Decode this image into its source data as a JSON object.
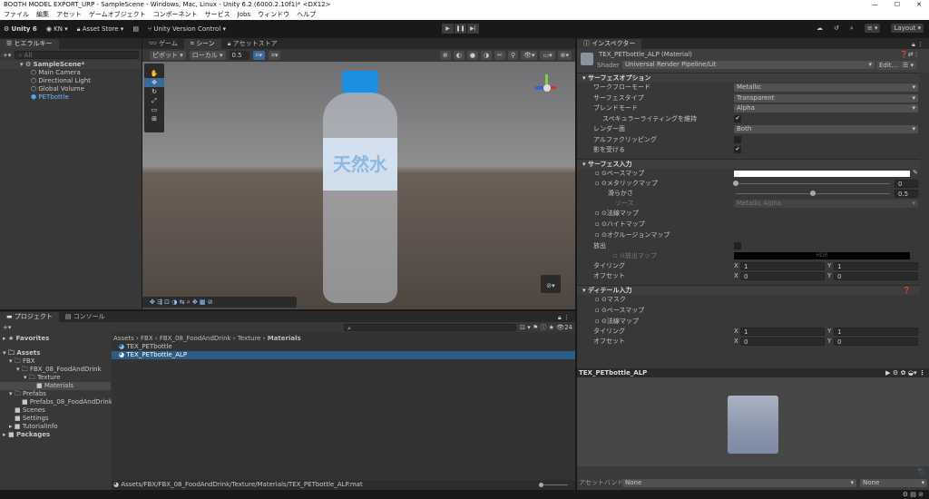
{
  "window": {
    "title": "BOOTH MODEL EXPORT_URP - SampleScene - Windows, Mac, Linux - Unity 6.2 (6000.2.10f1)* <DX12>"
  },
  "menu": [
    "ファイル",
    "編集",
    "アセット",
    "ゲームオブジェクト",
    "コンポーネント",
    "サービス",
    "Jobs",
    "ウィンドウ",
    "ヘルプ"
  ],
  "toolbar": {
    "unity": "Unity 6",
    "account": "KN",
    "asset_store": "Asset Store",
    "version_control": "Unity Version Control",
    "layout": "Layout"
  },
  "hierarchy": {
    "tab": "ヒエラルキー",
    "search_placeholder": "All",
    "scene": "SampleScene*",
    "items": [
      "Main Camera",
      "Directional Light",
      "Global Volume",
      "PETbottle"
    ]
  },
  "scene_tabs": [
    "ゲーム",
    "シーン",
    "アセットストア"
  ],
  "scene_toolbar": {
    "pivot": "ピボット",
    "local": "ローカル",
    "snap": "0.5"
  },
  "bottle_label": "天然水",
  "inspector": {
    "tab": "インスペクター",
    "name": "TEX_PETbottle_ALP (Material)",
    "shader_label": "Shader",
    "shader": "Universal Render Pipeline/Lit",
    "edit": "Edit...",
    "surface_options": {
      "title": "サーフェスオプション",
      "rows": [
        {
          "label": "ワークフローモード",
          "value": "Metallic"
        },
        {
          "label": "サーフェスタイプ",
          "value": "Transparent"
        },
        {
          "label": "ブレンドモード",
          "value": "Alpha"
        },
        {
          "label": "スペキュラーライティングを維持",
          "check": "✔"
        },
        {
          "label": "レンダー面",
          "value": "Both"
        },
        {
          "label": "アルファクリッピング",
          "check": ""
        },
        {
          "label": "影を受ける",
          "check": "✔"
        }
      ]
    },
    "surface_inputs": {
      "title": "サーフェス入力",
      "base_map": "ベースマップ",
      "metallic_map": "メタリックマップ",
      "metallic": "0",
      "metallic_value": 0,
      "smoothness": "滑らかさ",
      "smoothness_val": "0.5",
      "smoothness_value": 0.5,
      "source": "ソース",
      "source_val": "Metallic Alpha",
      "normal": "法線マップ",
      "height": "ハイトマップ",
      "occlusion": "オクルージョンマップ",
      "emission": "放出",
      "emission_map": "放出マップ",
      "hdr": "HDR",
      "tiling": "タイリング",
      "offset": "オフセット",
      "x": "X",
      "y": "Y",
      "t1": "1",
      "t2": "1",
      "o1": "0",
      "o2": "0"
    },
    "detail_inputs": {
      "title": "ディテール入力",
      "mask": "マスク",
      "base_map": "ベースマップ",
      "normal": "法線マップ",
      "tiling": "タイリング",
      "offset": "オフセット",
      "t1": "1",
      "t2": "1",
      "o1": "0",
      "o2": "0"
    },
    "preview_title": "TEX_PETbottle_ALP",
    "asset_bundle": "アセットバンドル",
    "bundle1": "None",
    "bundle2": "None"
  },
  "project": {
    "tabs": [
      "プロジェクト",
      "コンソール"
    ],
    "favorites": "Favorites",
    "tree": [
      "Assets",
      "FBX",
      "FBX_08_FoodAndDrink",
      "Texture",
      "Materials",
      "Prefabs",
      "Prefabs_08_FoodAndDrink",
      "Scenes",
      "Settings",
      "TutorialInfo",
      "Packages"
    ],
    "breadcrumb": [
      "Assets",
      "FBX",
      "FBX_08_FoodAndDrink",
      "Texture",
      "Materials"
    ],
    "files": [
      "TEX_PETbottle",
      "TEX_PETbottle_ALP"
    ],
    "count": "24",
    "path": "Assets/FBX/FBX_08_FoodAndDrink/Texture/Materials/TEX_PETbottle_ALP.mat"
  }
}
